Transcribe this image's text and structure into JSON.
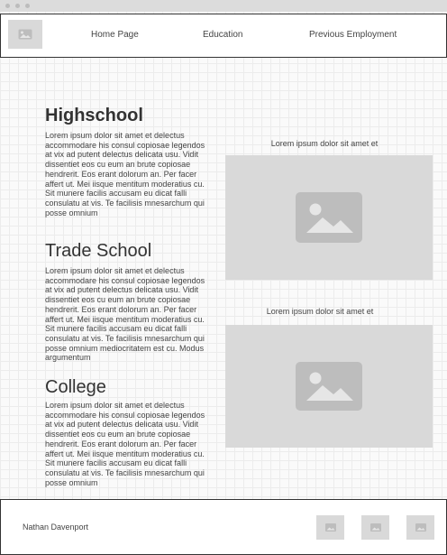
{
  "nav": {
    "items": [
      {
        "label": "Home Page"
      },
      {
        "label": "Education"
      },
      {
        "label": "Previous Employment"
      }
    ]
  },
  "sections": [
    {
      "heading": "Highschool",
      "text": "Lorem ipsum dolor sit amet et delectus accommodare his consul copiosae legendos at vix ad putent delectus delicata usu. Vidit dissentiet eos cu eum an brute copiosae hendrerit. Eos erant dolorum an. Per facer affert ut. Mei iisque mentitum moderatius cu. Sit munere facilis accusam eu dicat falli consulatu at vis. Te facilisis mnesarchum qui posse omnium"
    },
    {
      "heading": "Trade School",
      "text": "Lorem ipsum dolor sit amet et delectus accommodare his consul copiosae legendos at vix ad putent delectus delicata usu. Vidit dissentiet eos cu eum an brute copiosae hendrerit. Eos erant dolorum an. Per facer affert ut. Mei iisque mentitum moderatius cu. Sit munere facilis accusam eu dicat falli consulatu at vis. Te facilisis mnesarchum qui posse omnium mediocritatem est cu. Modus argumentum"
    },
    {
      "heading": "College",
      "text": "Lorem ipsum dolor sit amet et delectus accommodare his consul copiosae legendos at vix ad putent delectus delicata usu. Vidit dissentiet eos cu eum an brute copiosae hendrerit. Eos erant dolorum an. Per facer affert ut. Mei iisque mentitum moderatius cu. Sit munere facilis accusam eu dicat falli consulatu at vis. Te facilisis mnesarchum qui posse omnium"
    }
  ],
  "images": [
    {
      "caption": "Lorem ipsum dolor sit amet et",
      "icon": "image-placeholder-icon"
    },
    {
      "caption": "Lorem ipsum dolor sit amet et",
      "icon": "image-placeholder-icon"
    }
  ],
  "footer": {
    "name": "Nathan Davenport",
    "social_icons": [
      "image-placeholder-icon",
      "image-placeholder-icon",
      "image-placeholder-icon"
    ]
  },
  "colors": {
    "placeholder": "#d9d9d9",
    "placeholder_icon": "#bdbdbd",
    "border": "#333333"
  }
}
